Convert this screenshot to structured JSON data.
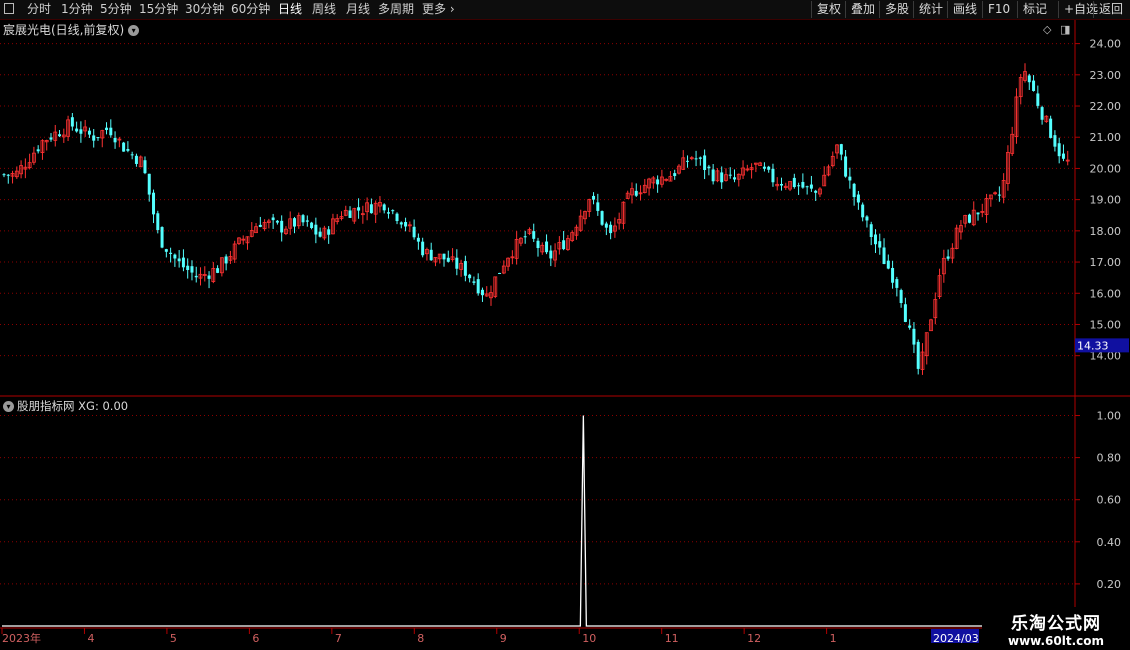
{
  "toolbar": {
    "periods": [
      "分时",
      "1分钟",
      "5分钟",
      "15分钟",
      "30分钟",
      "60分钟",
      "日线",
      "周线",
      "月线",
      "多周期",
      "更多"
    ],
    "active_period": "日线",
    "right_buttons": [
      "复权",
      "叠加",
      "多股",
      "统计",
      "画线",
      "F10",
      "标记",
      "+自选",
      "返回"
    ]
  },
  "main_panel": {
    "title": "宸展光电(日线,前复权)"
  },
  "indicator_panel": {
    "title": "股朋指标网",
    "series_label": "XG: 0.00"
  },
  "watermark": {
    "title": "乐淘公式网",
    "url": "www.60lt.com"
  },
  "colors": {
    "up": "#ff3232",
    "down": "#54ffff",
    "grid": "#8b0000",
    "axis_text": "#c8c8c8",
    "indicator_line": "#ffffff",
    "price_marker_bg": "#1010a0"
  },
  "chart_data": [
    {
      "type": "candlestick",
      "title": "宸展光电(日线,前复权)",
      "y_ticks": [
        "24.00",
        "23.00",
        "22.00",
        "21.00",
        "20.00",
        "19.00",
        "18.00",
        "17.00",
        "16.00",
        "15.00",
        "14.00"
      ],
      "ylim": [
        12.9,
        24.5
      ],
      "current_price_marker": "14.33",
      "x_tick_labels": [
        "2023年",
        "4",
        "5",
        "6",
        "7",
        "8",
        "9",
        "10",
        "11",
        "12",
        "1",
        "2024/03"
      ],
      "x_tick_dates": [
        "2023-03",
        "2023-04",
        "2023-05",
        "2023-06",
        "2023-07",
        "2023-08",
        "2023-09",
        "2023-10",
        "2023-11",
        "2023-12",
        "2024-01",
        "2024-03"
      ],
      "close_path": [
        [
          "2023-03",
          19.8
        ],
        [
          "2023-03",
          20.9
        ],
        [
          "2023-03",
          21.4
        ],
        [
          "2023-04",
          21.0
        ],
        [
          "2023-04",
          21.3
        ],
        [
          "2023-04",
          20.6
        ],
        [
          "2023-04",
          20.2
        ],
        [
          "2023-04",
          17.8
        ],
        [
          "2023-05",
          17.0
        ],
        [
          "2023-05",
          16.5
        ],
        [
          "2023-05",
          16.8
        ],
        [
          "2023-05",
          17.6
        ],
        [
          "2023-06",
          18.3
        ],
        [
          "2023-06",
          18.1
        ],
        [
          "2023-06",
          18.3
        ],
        [
          "2023-06",
          17.8
        ],
        [
          "2023-07",
          18.6
        ],
        [
          "2023-07",
          18.7
        ],
        [
          "2023-07",
          18.9
        ],
        [
          "2023-07",
          18.3
        ],
        [
          "2023-08",
          17.3
        ],
        [
          "2023-08",
          17.1
        ],
        [
          "2023-08",
          16.7
        ],
        [
          "2023-08",
          15.9
        ],
        [
          "2023-09",
          17.2
        ],
        [
          "2023-09",
          17.9
        ],
        [
          "2023-09",
          17.1
        ],
        [
          "2023-09",
          17.8
        ],
        [
          "2023-10",
          19.1
        ],
        [
          "2023-10",
          17.8
        ],
        [
          "2023-10",
          19.2
        ],
        [
          "2023-10",
          19.6
        ],
        [
          "2023-11",
          19.8
        ],
        [
          "2023-11",
          20.4
        ],
        [
          "2023-11",
          19.8
        ],
        [
          "2023-11",
          19.6
        ],
        [
          "2023-12",
          20.1
        ],
        [
          "2023-12",
          19.6
        ],
        [
          "2023-12",
          19.5
        ],
        [
          "2023-12",
          19.2
        ],
        [
          "2024-01",
          20.7
        ],
        [
          "2024-01",
          18.8
        ],
        [
          "2024-01",
          17.4
        ],
        [
          "2024-01",
          16.2
        ],
        [
          "2024-02",
          13.4
        ],
        [
          "2024-02",
          16.7
        ],
        [
          "2024-02",
          18.2
        ],
        [
          "2024-02",
          18.7
        ],
        [
          "2024-03",
          19.2
        ],
        [
          "2024-03",
          23.3
        ],
        [
          "2024-03",
          21.7
        ],
        [
          "2024-03",
          20.2
        ]
      ]
    },
    {
      "type": "line",
      "title": "股朋指标网",
      "series": [
        {
          "name": "XG",
          "value_label": "XG: 0.00"
        }
      ],
      "y_ticks": [
        "1.00",
        "0.80",
        "0.60",
        "0.40",
        "0.20"
      ],
      "ylim": [
        0,
        1.05
      ],
      "signal": {
        "date": "2023-10",
        "value": 1.0
      },
      "baseline": 0
    }
  ]
}
